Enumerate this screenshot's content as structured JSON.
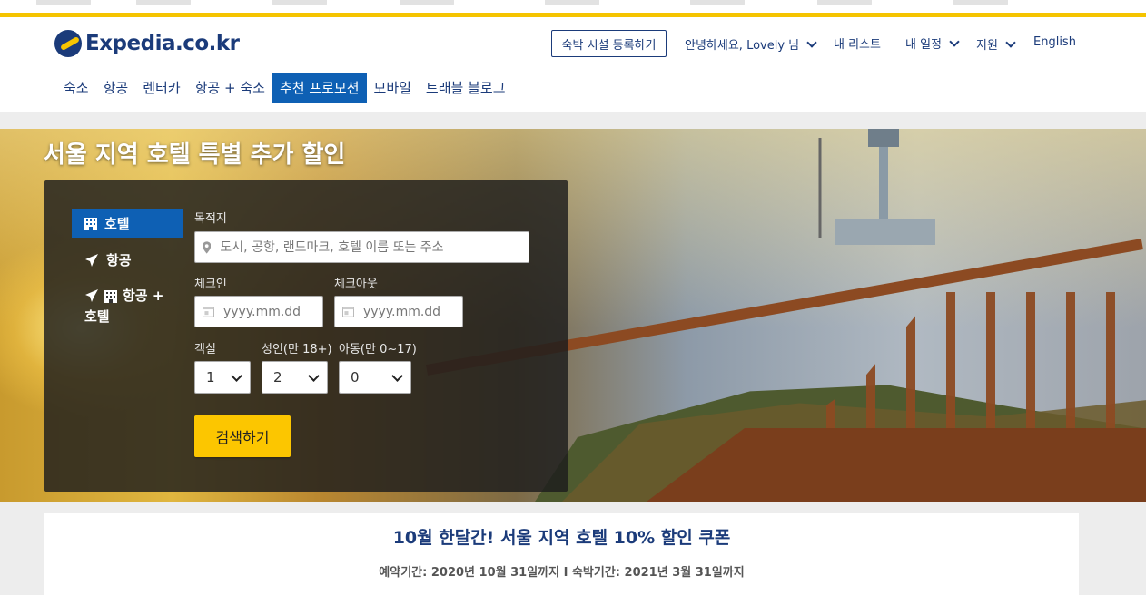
{
  "header": {
    "logo_text": "Expedia.co.kr",
    "list_property": "숙박 시설 등록하기",
    "greeting": "안녕하세요, Lovely 님",
    "my_list": "내 리스트",
    "my_trips": "내 일정",
    "support": "지원",
    "language": "English"
  },
  "nav": {
    "items": [
      "숙소",
      "항공",
      "렌터카",
      "항공 + 숙소",
      "추천 프로모션",
      "모바일",
      "트래블 블로그"
    ],
    "active_index": 4
  },
  "hero": {
    "title": "서울 지역 호텔 특별 추가 할인"
  },
  "search": {
    "tabs": {
      "hotel": "호텔",
      "flight": "항공",
      "package_line1": "항공 +",
      "package_line2": "호텔"
    },
    "destination_label": "목적지",
    "destination_placeholder": "도시, 공항, 랜드마크, 호텔 이름 또는 주소",
    "checkin_label": "체크인",
    "checkout_label": "체크아웃",
    "date_placeholder": "yyyy.mm.dd",
    "rooms_label": "객실",
    "adults_label": "성인(만 18+)",
    "children_label": "아동(만 0~17)",
    "rooms_value": "1",
    "adults_value": "2",
    "children_value": "0",
    "search_button": "검색하기"
  },
  "promo": {
    "title": "10월 한달간! 서울 지역 호텔 10% 할인 쿠폰",
    "subtitle": "예약기간: 2020년 10월 31일까지 I 숙박기간: 2021년 3월 31일까지"
  },
  "colors": {
    "brand_navy": "#1b3b7a",
    "nav_active": "#0e60b4",
    "accent_yellow": "#fcc600"
  }
}
